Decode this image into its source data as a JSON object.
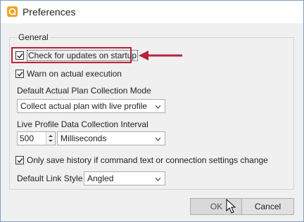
{
  "window": {
    "title": "Preferences"
  },
  "group": {
    "label": "General"
  },
  "checks": {
    "updates": "Check for updates on startup",
    "warn": "Warn on actual execution",
    "history": "Only save history if command text or connection settings change"
  },
  "fields": {
    "plan_mode_label": "Default Actual Plan Collection Mode",
    "plan_mode_value": "Collect actual plan with live profile",
    "interval_label": "Live Profile Data Collection Interval",
    "interval_value": "500",
    "interval_unit": "Milliseconds",
    "link_label": "Default Link Style",
    "link_value": "Angled"
  },
  "buttons": {
    "ok": "OK",
    "cancel": "Cancel"
  },
  "colors": {
    "highlight": "#b5243a",
    "icon": "#f0a020"
  }
}
